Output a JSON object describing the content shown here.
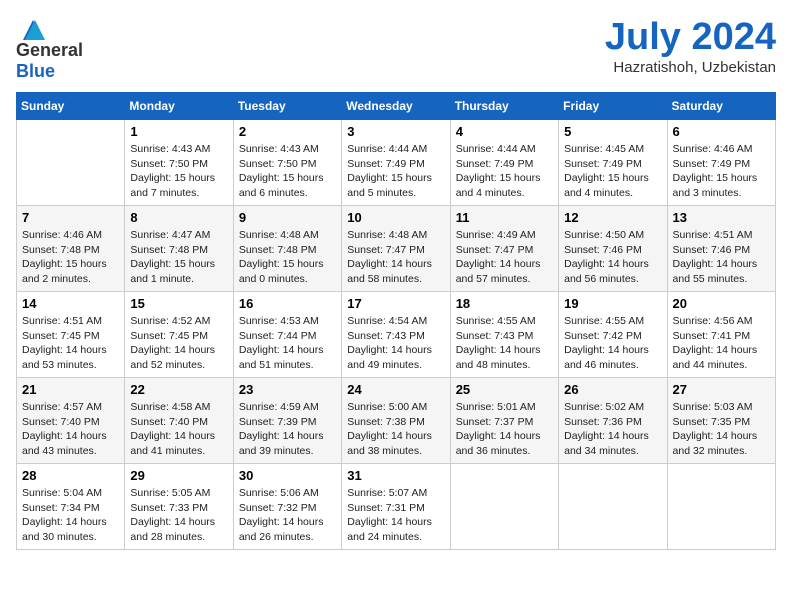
{
  "header": {
    "logo_line1": "General",
    "logo_line2": "Blue",
    "month": "July 2024",
    "location": "Hazratishoh, Uzbekistan"
  },
  "weekdays": [
    "Sunday",
    "Monday",
    "Tuesday",
    "Wednesday",
    "Thursday",
    "Friday",
    "Saturday"
  ],
  "weeks": [
    [
      {
        "day": "",
        "sunrise": "",
        "sunset": "",
        "daylight": ""
      },
      {
        "day": "1",
        "sunrise": "Sunrise: 4:43 AM",
        "sunset": "Sunset: 7:50 PM",
        "daylight": "Daylight: 15 hours and 7 minutes."
      },
      {
        "day": "2",
        "sunrise": "Sunrise: 4:43 AM",
        "sunset": "Sunset: 7:50 PM",
        "daylight": "Daylight: 15 hours and 6 minutes."
      },
      {
        "day": "3",
        "sunrise": "Sunrise: 4:44 AM",
        "sunset": "Sunset: 7:49 PM",
        "daylight": "Daylight: 15 hours and 5 minutes."
      },
      {
        "day": "4",
        "sunrise": "Sunrise: 4:44 AM",
        "sunset": "Sunset: 7:49 PM",
        "daylight": "Daylight: 15 hours and 4 minutes."
      },
      {
        "day": "5",
        "sunrise": "Sunrise: 4:45 AM",
        "sunset": "Sunset: 7:49 PM",
        "daylight": "Daylight: 15 hours and 4 minutes."
      },
      {
        "day": "6",
        "sunrise": "Sunrise: 4:46 AM",
        "sunset": "Sunset: 7:49 PM",
        "daylight": "Daylight: 15 hours and 3 minutes."
      }
    ],
    [
      {
        "day": "7",
        "sunrise": "Sunrise: 4:46 AM",
        "sunset": "Sunset: 7:48 PM",
        "daylight": "Daylight: 15 hours and 2 minutes."
      },
      {
        "day": "8",
        "sunrise": "Sunrise: 4:47 AM",
        "sunset": "Sunset: 7:48 PM",
        "daylight": "Daylight: 15 hours and 1 minute."
      },
      {
        "day": "9",
        "sunrise": "Sunrise: 4:48 AM",
        "sunset": "Sunset: 7:48 PM",
        "daylight": "Daylight: 15 hours and 0 minutes."
      },
      {
        "day": "10",
        "sunrise": "Sunrise: 4:48 AM",
        "sunset": "Sunset: 7:47 PM",
        "daylight": "Daylight: 14 hours and 58 minutes."
      },
      {
        "day": "11",
        "sunrise": "Sunrise: 4:49 AM",
        "sunset": "Sunset: 7:47 PM",
        "daylight": "Daylight: 14 hours and 57 minutes."
      },
      {
        "day": "12",
        "sunrise": "Sunrise: 4:50 AM",
        "sunset": "Sunset: 7:46 PM",
        "daylight": "Daylight: 14 hours and 56 minutes."
      },
      {
        "day": "13",
        "sunrise": "Sunrise: 4:51 AM",
        "sunset": "Sunset: 7:46 PM",
        "daylight": "Daylight: 14 hours and 55 minutes."
      }
    ],
    [
      {
        "day": "14",
        "sunrise": "Sunrise: 4:51 AM",
        "sunset": "Sunset: 7:45 PM",
        "daylight": "Daylight: 14 hours and 53 minutes."
      },
      {
        "day": "15",
        "sunrise": "Sunrise: 4:52 AM",
        "sunset": "Sunset: 7:45 PM",
        "daylight": "Daylight: 14 hours and 52 minutes."
      },
      {
        "day": "16",
        "sunrise": "Sunrise: 4:53 AM",
        "sunset": "Sunset: 7:44 PM",
        "daylight": "Daylight: 14 hours and 51 minutes."
      },
      {
        "day": "17",
        "sunrise": "Sunrise: 4:54 AM",
        "sunset": "Sunset: 7:43 PM",
        "daylight": "Daylight: 14 hours and 49 minutes."
      },
      {
        "day": "18",
        "sunrise": "Sunrise: 4:55 AM",
        "sunset": "Sunset: 7:43 PM",
        "daylight": "Daylight: 14 hours and 48 minutes."
      },
      {
        "day": "19",
        "sunrise": "Sunrise: 4:55 AM",
        "sunset": "Sunset: 7:42 PM",
        "daylight": "Daylight: 14 hours and 46 minutes."
      },
      {
        "day": "20",
        "sunrise": "Sunrise: 4:56 AM",
        "sunset": "Sunset: 7:41 PM",
        "daylight": "Daylight: 14 hours and 44 minutes."
      }
    ],
    [
      {
        "day": "21",
        "sunrise": "Sunrise: 4:57 AM",
        "sunset": "Sunset: 7:40 PM",
        "daylight": "Daylight: 14 hours and 43 minutes."
      },
      {
        "day": "22",
        "sunrise": "Sunrise: 4:58 AM",
        "sunset": "Sunset: 7:40 PM",
        "daylight": "Daylight: 14 hours and 41 minutes."
      },
      {
        "day": "23",
        "sunrise": "Sunrise: 4:59 AM",
        "sunset": "Sunset: 7:39 PM",
        "daylight": "Daylight: 14 hours and 39 minutes."
      },
      {
        "day": "24",
        "sunrise": "Sunrise: 5:00 AM",
        "sunset": "Sunset: 7:38 PM",
        "daylight": "Daylight: 14 hours and 38 minutes."
      },
      {
        "day": "25",
        "sunrise": "Sunrise: 5:01 AM",
        "sunset": "Sunset: 7:37 PM",
        "daylight": "Daylight: 14 hours and 36 minutes."
      },
      {
        "day": "26",
        "sunrise": "Sunrise: 5:02 AM",
        "sunset": "Sunset: 7:36 PM",
        "daylight": "Daylight: 14 hours and 34 minutes."
      },
      {
        "day": "27",
        "sunrise": "Sunrise: 5:03 AM",
        "sunset": "Sunset: 7:35 PM",
        "daylight": "Daylight: 14 hours and 32 minutes."
      }
    ],
    [
      {
        "day": "28",
        "sunrise": "Sunrise: 5:04 AM",
        "sunset": "Sunset: 7:34 PM",
        "daylight": "Daylight: 14 hours and 30 minutes."
      },
      {
        "day": "29",
        "sunrise": "Sunrise: 5:05 AM",
        "sunset": "Sunset: 7:33 PM",
        "daylight": "Daylight: 14 hours and 28 minutes."
      },
      {
        "day": "30",
        "sunrise": "Sunrise: 5:06 AM",
        "sunset": "Sunset: 7:32 PM",
        "daylight": "Daylight: 14 hours and 26 minutes."
      },
      {
        "day": "31",
        "sunrise": "Sunrise: 5:07 AM",
        "sunset": "Sunset: 7:31 PM",
        "daylight": "Daylight: 14 hours and 24 minutes."
      },
      {
        "day": "",
        "sunrise": "",
        "sunset": "",
        "daylight": ""
      },
      {
        "day": "",
        "sunrise": "",
        "sunset": "",
        "daylight": ""
      },
      {
        "day": "",
        "sunrise": "",
        "sunset": "",
        "daylight": ""
      }
    ]
  ]
}
